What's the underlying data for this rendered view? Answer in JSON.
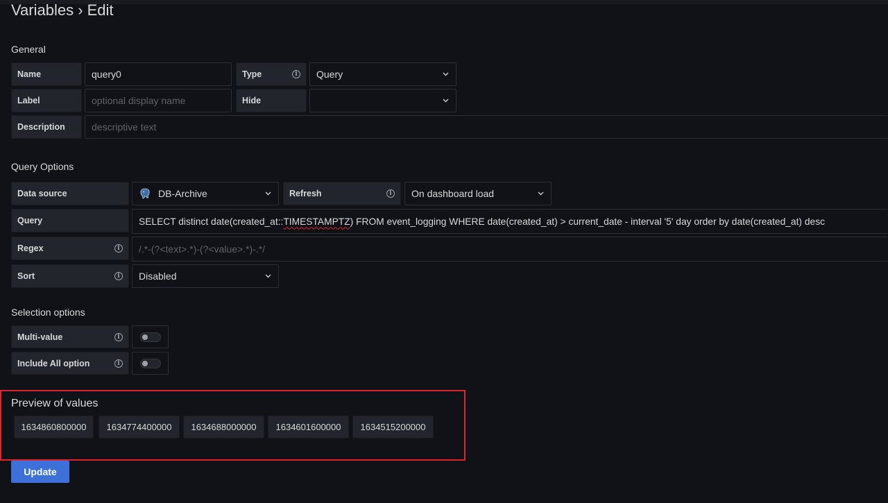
{
  "page": {
    "title": "Variables › Edit"
  },
  "general": {
    "section_title": "General",
    "name_label": "Name",
    "name_value": "query0",
    "type_label": "Type",
    "type_value": "Query",
    "label_label": "Label",
    "label_placeholder": "optional display name",
    "hide_label": "Hide",
    "hide_value": "",
    "description_label": "Description",
    "description_placeholder": "descriptive text"
  },
  "query_options": {
    "section_title": "Query Options",
    "datasource_label": "Data source",
    "datasource_value": "DB-Archive",
    "datasource_icon": "postgres-elephant-icon",
    "refresh_label": "Refresh",
    "refresh_value": "On dashboard load",
    "query_label": "Query",
    "query_prefix": "SELECT distinct date(created_at::",
    "query_flagged": "TIMESTAMPTZ",
    "query_suffix": ") FROM event_logging WHERE date(created_at) > current_date - interval '5' day order by date(created_at) desc",
    "regex_label": "Regex",
    "regex_placeholder": "/.*-(?<text>.*)-(?<value>.*)-.*/",
    "sort_label": "Sort",
    "sort_value": "Disabled"
  },
  "selection_options": {
    "section_title": "Selection options",
    "multi_value_label": "Multi-value",
    "multi_value_on": false,
    "include_all_label": "Include All option",
    "include_all_on": false
  },
  "preview": {
    "section_title": "Preview of values",
    "values": [
      "1634860800000",
      "1634774400000",
      "1634688000000",
      "1634601600000",
      "1634515200000"
    ]
  },
  "actions": {
    "update_label": "Update"
  },
  "colors": {
    "background": "#111217",
    "label_bg": "#22252b",
    "primary": "#3d71d9",
    "highlight_border": "#e0242c"
  }
}
